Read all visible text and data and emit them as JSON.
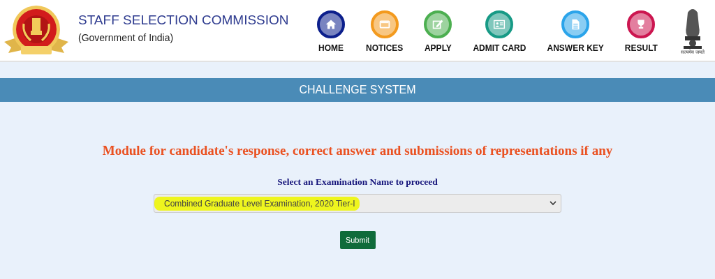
{
  "header": {
    "title": "STAFF SELECTION COMMISSION",
    "subtitle": "(Government of India)",
    "emblem_motto": "सत्यमेव जयते"
  },
  "nav": [
    {
      "label": "HOME",
      "kind": "home",
      "color": "#0c1f8c"
    },
    {
      "label": "NOTICES",
      "kind": "notices",
      "color": "#f39a1e"
    },
    {
      "label": "APPLY",
      "kind": "apply",
      "color": "#4caf50"
    },
    {
      "label": "ADMIT CARD",
      "kind": "admit",
      "color": "#179a86"
    },
    {
      "label": "ANSWER KEY",
      "kind": "answer",
      "color": "#2ba4ea"
    },
    {
      "label": "RESULT",
      "kind": "result",
      "color": "#cc1650"
    }
  ],
  "banner": {
    "title": "CHALLENGE SYSTEM"
  },
  "heading": "Module for candidate's response, correct answer and submissions of representations if any",
  "select": {
    "label": "Select an Examination Name to proceed",
    "value": "Combined Graduate Level Examination, 2020 Tier-I",
    "highlighted": true
  },
  "submit": "Submit"
}
